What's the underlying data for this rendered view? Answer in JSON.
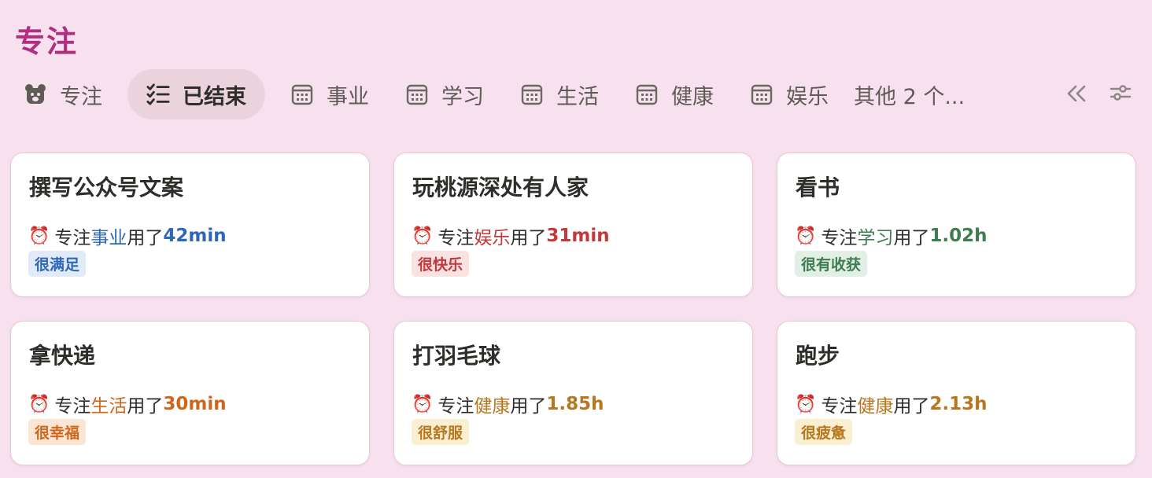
{
  "page": {
    "title": "专注"
  },
  "tabs": [
    {
      "label": "专注",
      "icon": "bear-icon"
    },
    {
      "label": "已结束",
      "icon": "checklist-icon",
      "active": true
    },
    {
      "label": "事业",
      "icon": "calendar-icon"
    },
    {
      "label": "学习",
      "icon": "calendar-icon"
    },
    {
      "label": "生活",
      "icon": "calendar-icon"
    },
    {
      "label": "健康",
      "icon": "calendar-icon"
    },
    {
      "label": "娱乐",
      "icon": "calendar-icon"
    }
  ],
  "tabs_overflow": "其他 2 个...",
  "toolbar": {
    "collapse_icon": "double-chevron-left-icon",
    "filter_icon": "sliders-icon"
  },
  "common": {
    "prefix": "专注",
    "verb": "用了",
    "alarm": "⏰"
  },
  "colors": {
    "blue": "#2e66b8",
    "blue_bg": "#e1ebf8",
    "red": "#c0393b",
    "red_bg": "#fae2e2",
    "green": "#3f7c52",
    "green_bg": "#e2efe6",
    "orange": "#d0661c",
    "orange_bg": "#fbe5d4",
    "gold": "#b7771e",
    "gold_bg": "#fbefd2"
  },
  "cards": [
    {
      "title": "撰写公众号文案",
      "category": "事业",
      "duration": "42min",
      "tag": "很满足",
      "color": "blue"
    },
    {
      "title": "玩桃源深处有人家",
      "category": "娱乐",
      "duration": "31min",
      "tag": "很快乐",
      "color": "red"
    },
    {
      "title": "看书",
      "category": "学习",
      "duration": "1.02h",
      "tag": "很有收获",
      "color": "green"
    },
    {
      "title": "拿快递",
      "category": "生活",
      "duration": "30min",
      "tag": "很幸福",
      "color": "orange"
    },
    {
      "title": "打羽毛球",
      "category": "健康",
      "duration": "1.85h",
      "tag": "很舒服",
      "color": "gold"
    },
    {
      "title": "跑步",
      "category": "健康",
      "duration": "2.13h",
      "tag": "很疲惫",
      "color": "gold"
    }
  ]
}
